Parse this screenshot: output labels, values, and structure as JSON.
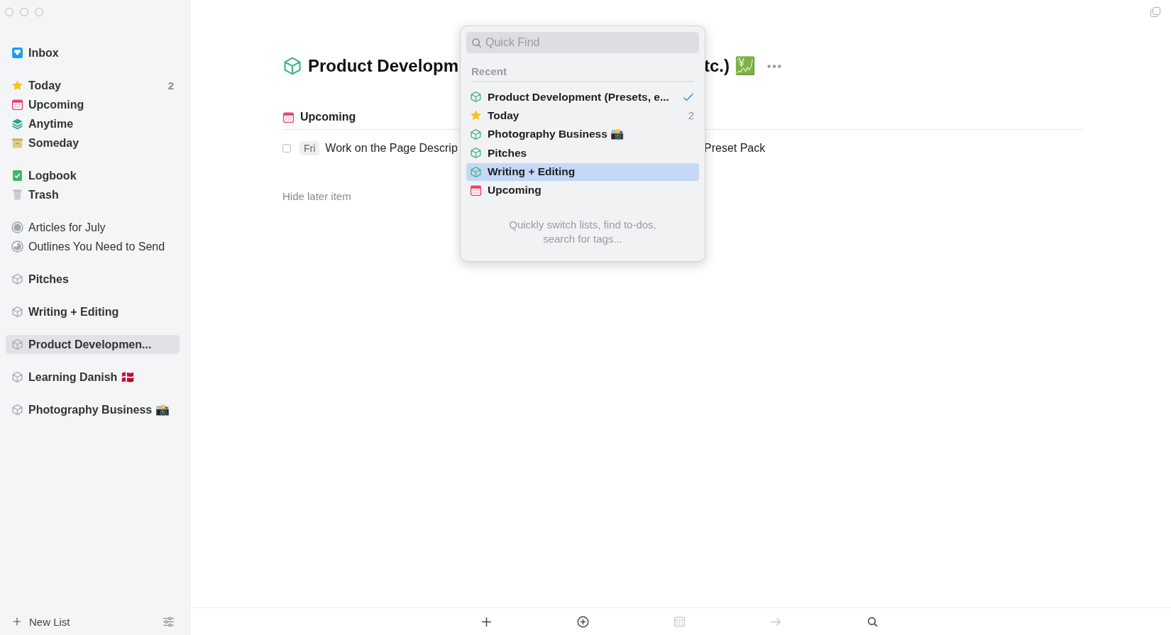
{
  "sidebar": {
    "groups": [
      {
        "items": [
          {
            "kind": "inbox",
            "label": "Inbox",
            "selected": false
          }
        ]
      },
      {
        "items": [
          {
            "kind": "today",
            "label": "Today",
            "count": "2",
            "selected": false
          },
          {
            "kind": "upcoming",
            "label": "Upcoming",
            "selected": false
          },
          {
            "kind": "anytime",
            "label": "Anytime",
            "selected": false
          },
          {
            "kind": "someday",
            "label": "Someday",
            "selected": false
          }
        ]
      },
      {
        "items": [
          {
            "kind": "logbook",
            "label": "Logbook",
            "selected": false
          },
          {
            "kind": "trash",
            "label": "Trash",
            "selected": false
          }
        ]
      },
      {
        "items": [
          {
            "kind": "project",
            "label": "Articles for July",
            "complete": true,
            "selected": false
          },
          {
            "kind": "project",
            "label": "Outlines You Need to Send",
            "complete": false,
            "selected": false
          }
        ]
      },
      {
        "items": [
          {
            "kind": "area",
            "label": "Pitches",
            "selected": false
          }
        ]
      },
      {
        "items": [
          {
            "kind": "area",
            "label": "Writing + Editing",
            "selected": false
          }
        ]
      },
      {
        "items": [
          {
            "kind": "area",
            "label": "Product Developmen...",
            "selected": true
          }
        ]
      },
      {
        "items": [
          {
            "kind": "area",
            "label": "Learning Danish 🇩🇰",
            "selected": false
          }
        ]
      },
      {
        "items": [
          {
            "kind": "area",
            "label": "Photography Business 📸",
            "selected": false
          }
        ]
      }
    ],
    "footer": {
      "new_list": "New List"
    }
  },
  "main": {
    "title_start": "Product Developm",
    "title_end": "tc.) 💹",
    "section": {
      "kind": "upcoming",
      "title": "Upcoming"
    },
    "tasks": [
      {
        "checked": false,
        "when": "Fri",
        "text_start": "Work on the Page Descrip",
        "text_end": "Preset Pack"
      }
    ],
    "hide_later": "Hide later item"
  },
  "toolbar": [
    {
      "kind": "add",
      "disabled": false
    },
    {
      "kind": "add-circle",
      "disabled": false
    },
    {
      "kind": "calendar",
      "disabled": true
    },
    {
      "kind": "move",
      "disabled": true
    },
    {
      "kind": "search",
      "disabled": false
    }
  ],
  "quick_find": {
    "placeholder": "Quick Find",
    "section": "Recent",
    "items": [
      {
        "kind": "area",
        "label": "Product Development (Presets, e...",
        "checked": true,
        "selected": false
      },
      {
        "kind": "today",
        "label": "Today",
        "count": "2",
        "checked": false,
        "selected": false
      },
      {
        "kind": "area",
        "label": "Photography Business 📸",
        "checked": false,
        "selected": false
      },
      {
        "kind": "area",
        "label": "Pitches",
        "checked": false,
        "selected": false
      },
      {
        "kind": "area",
        "label": "Writing + Editing",
        "checked": false,
        "selected": true
      },
      {
        "kind": "upcoming",
        "label": "Upcoming",
        "checked": false,
        "selected": false
      }
    ],
    "hint": "Quickly switch lists, find to-dos,\nsearch for tags..."
  }
}
